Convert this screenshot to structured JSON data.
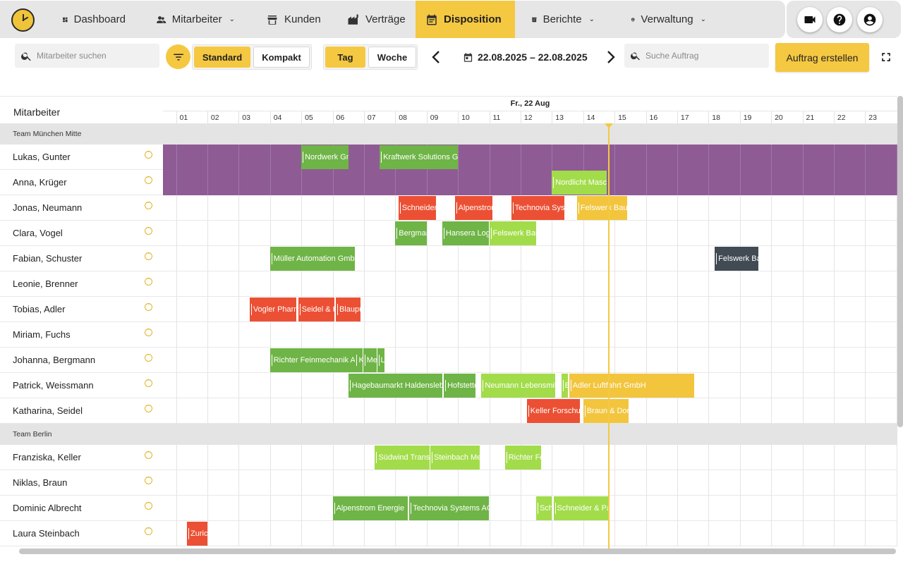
{
  "nav": {
    "items": [
      {
        "label": "Dashboard",
        "icon": "dashboard-icon",
        "chevron": false
      },
      {
        "label": "Mitarbeiter",
        "icon": "people-icon",
        "chevron": true
      },
      {
        "label": "Kunden",
        "icon": "store-icon",
        "chevron": false
      },
      {
        "label": "Verträge",
        "icon": "factory-icon",
        "chevron": false
      },
      {
        "label": "Disposition",
        "icon": "calendar-icon",
        "chevron": false,
        "active": true
      },
      {
        "label": "Berichte",
        "icon": "archive-icon",
        "chevron": true
      },
      {
        "label": "Verwaltung",
        "icon": "admin-shield-icon",
        "chevron": true
      }
    ],
    "chevron_glyph": "⌄",
    "actions": [
      "video-camera-icon",
      "help-icon",
      "account-icon"
    ]
  },
  "toolbar": {
    "employee_search_placeholder": "Mitarbeiter suchen",
    "view_standard": "Standard",
    "view_compact": "Kompakt",
    "range_day": "Tag",
    "range_week": "Woche",
    "date_range": "22.08.2025 – 22.08.2025",
    "order_search_placeholder": "Suche Auftrag",
    "create_order": "Auftrag erstellen"
  },
  "grid": {
    "employees_header": "Mitarbeiter",
    "day_label": "Fr., 22 Aug",
    "hours": [
      "01",
      "02",
      "03",
      "04",
      "05",
      "06",
      "07",
      "08",
      "09",
      "10",
      "11",
      "12",
      "13",
      "14",
      "15",
      "16",
      "17",
      "18",
      "19",
      "20",
      "21",
      "22",
      "23"
    ],
    "now_hour": 14.8
  },
  "colors": {
    "accent": "#f5c842",
    "purple_blocked": "#8e5b94",
    "green": "#6fb446",
    "light_green": "#a2dc4a",
    "red": "#ec5034",
    "yellow_order": "#f2c53d",
    "dark": "#424a54",
    "team_bg": "#e4e4e4"
  },
  "rows": [
    {
      "type": "team",
      "label": "Team München Mitte"
    },
    {
      "type": "emp",
      "name": "Lukas, Gunter",
      "blocked": true,
      "tasks": [
        {
          "label": "Nordwerk GmbH",
          "start": 5.0,
          "end": 6.5,
          "color": "green"
        },
        {
          "label": "Kraftwerk Solutions GmbH",
          "start": 7.5,
          "end": 10.0,
          "color": "green"
        }
      ]
    },
    {
      "type": "emp",
      "name": "Anna, Krüger",
      "blocked": true,
      "tasks": [
        {
          "label": "Nordlicht Maschinenbau",
          "start": 13.0,
          "end": 14.75,
          "color": "light_green"
        }
      ]
    },
    {
      "type": "emp",
      "name": "Jonas, Neumann",
      "tasks": [
        {
          "label": "Schneider & Partner",
          "start": 8.1,
          "end": 9.3,
          "color": "red"
        },
        {
          "label": "Alpenstrom Energie",
          "start": 9.9,
          "end": 11.1,
          "color": "red"
        },
        {
          "label": "Technovia Systems AG",
          "start": 11.7,
          "end": 13.4,
          "color": "red"
        },
        {
          "label": "Felswerk Bau",
          "start": 13.8,
          "end": 15.4,
          "color": "yellow_order"
        }
      ]
    },
    {
      "type": "emp",
      "name": "Clara, Vogel",
      "tasks": [
        {
          "label": "Bergmann Logistik",
          "start": 8.0,
          "end": 9.0,
          "color": "green"
        },
        {
          "label": "Hansera Logistik",
          "start": 9.5,
          "end": 11.0,
          "color": "green"
        },
        {
          "label": "Felswerk Bau",
          "start": 11.0,
          "end": 12.5,
          "color": "light_green"
        }
      ]
    },
    {
      "type": "emp",
      "name": "Fabian, Schuster",
      "tasks": [
        {
          "label": "Müller Automation GmbH",
          "start": 4.0,
          "end": 6.7,
          "color": "green"
        },
        {
          "label": "Felswerk Bau",
          "start": 18.2,
          "end": 19.6,
          "color": "dark"
        }
      ]
    },
    {
      "type": "emp",
      "name": "Leonie, Brenner",
      "tasks": []
    },
    {
      "type": "emp",
      "name": "Tobias, Adler",
      "tasks": [
        {
          "label": "Vogler Pharma",
          "start": 3.35,
          "end": 4.85,
          "color": "red"
        },
        {
          "label": "Seidel & Hofmann",
          "start": 4.9,
          "end": 6.05,
          "color": "red"
        },
        {
          "label": "Blaupunkt",
          "start": 6.1,
          "end": 6.9,
          "color": "red"
        }
      ]
    },
    {
      "type": "emp",
      "name": "Miriam, Fuchs",
      "tasks": []
    },
    {
      "type": "emp",
      "name": "Johanna, Bergmann",
      "tasks": [
        {
          "label": "Richter Feinmechanik AG",
          "start": 4.0,
          "end": 6.7,
          "color": "green"
        },
        {
          "label": "Klein",
          "start": 6.72,
          "end": 6.95,
          "color": "green"
        },
        {
          "label": "Meier",
          "start": 6.97,
          "end": 7.4,
          "color": "green"
        },
        {
          "label": "Lutz",
          "start": 7.42,
          "end": 7.65,
          "color": "green"
        }
      ]
    },
    {
      "type": "emp",
      "name": "Patrick, Weissmann",
      "tasks": [
        {
          "label": "Hagebaumarkt Haldensleben",
          "start": 6.5,
          "end": 9.5,
          "color": "green"
        },
        {
          "label": "Hofstetter",
          "start": 9.55,
          "end": 10.55,
          "color": "green"
        },
        {
          "label": "Neumann Lebensmittel",
          "start": 10.75,
          "end": 13.1,
          "color": "light_green"
        },
        {
          "label": "Eder",
          "start": 13.3,
          "end": 13.52,
          "color": "light_green"
        },
        {
          "label": "Adler Luftfahrt GmbH",
          "start": 13.55,
          "end": 17.55,
          "color": "yellow_order"
        }
      ]
    },
    {
      "type": "emp",
      "name": "Katharina, Seidel",
      "tasks": [
        {
          "label": "Keller Forschung",
          "start": 12.2,
          "end": 13.9,
          "color": "red"
        },
        {
          "label": "Braun & Dorn",
          "start": 14.0,
          "end": 15.45,
          "color": "yellow_order"
        }
      ]
    },
    {
      "type": "team",
      "label": "Team Berlin"
    },
    {
      "type": "emp",
      "name": "Franziska, Keller",
      "tasks": [
        {
          "label": "Südwind Transporte",
          "start": 7.35,
          "end": 9.1,
          "color": "light_green"
        },
        {
          "label": "Steinbach Medien",
          "start": 9.12,
          "end": 10.7,
          "color": "light_green"
        },
        {
          "label": "Richter Feinmechanik",
          "start": 11.5,
          "end": 12.65,
          "color": "light_green"
        }
      ]
    },
    {
      "type": "emp",
      "name": "Niklas, Braun",
      "tasks": []
    },
    {
      "type": "emp",
      "name": "Dominic Albrecht",
      "tasks": [
        {
          "label": "Alpenstrom Energie",
          "start": 6.0,
          "end": 8.4,
          "color": "green"
        },
        {
          "label": "Technovia Systems AG",
          "start": 8.45,
          "end": 11.0,
          "color": "green"
        },
        {
          "label": "Schmid",
          "start": 12.5,
          "end": 13.0,
          "color": "light_green"
        },
        {
          "label": "Schneider & Partner",
          "start": 13.05,
          "end": 14.8,
          "color": "light_green"
        }
      ]
    },
    {
      "type": "emp",
      "name": "Laura Steinbach",
      "tasks": [
        {
          "label": "Zurich",
          "start": 1.35,
          "end": 2.0,
          "color": "red"
        }
      ]
    }
  ]
}
